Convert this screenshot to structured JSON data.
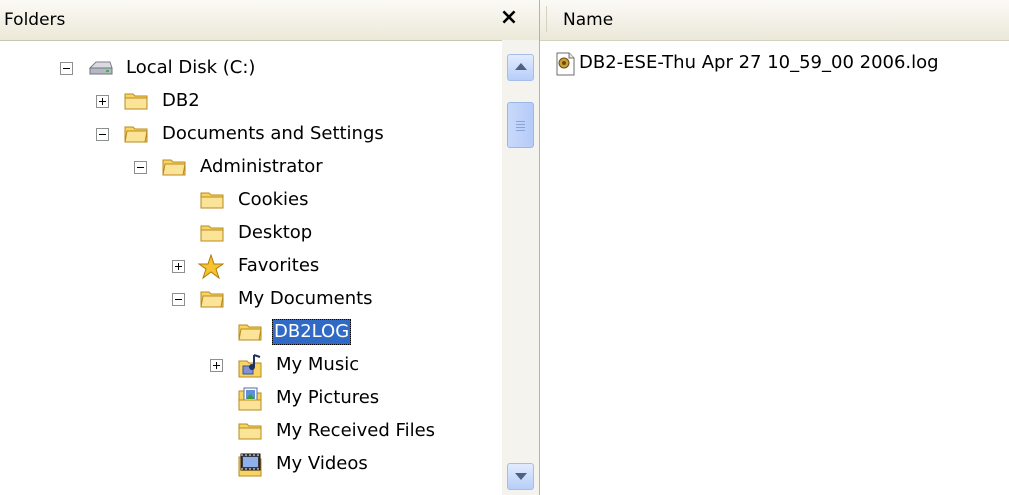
{
  "folders_pane": {
    "title": "Folders",
    "close_glyph": "×"
  },
  "tree": [
    {
      "label": "Local Disk (C:)",
      "icon": "drive-icon",
      "expander": "minus"
    },
    {
      "label": "DB2",
      "icon": "folder-icon",
      "expander": "plus"
    },
    {
      "label": "Documents and Settings",
      "icon": "folder-icon",
      "expander": "minus"
    },
    {
      "label": "Administrator",
      "icon": "folder-icon",
      "expander": "minus"
    },
    {
      "label": "Cookies",
      "icon": "folder-icon",
      "expander": "none"
    },
    {
      "label": "Desktop",
      "icon": "folder-icon",
      "expander": "none"
    },
    {
      "label": "Favorites",
      "icon": "favorites-star-icon",
      "expander": "plus"
    },
    {
      "label": "My Documents",
      "icon": "folder-icon",
      "expander": "minus"
    },
    {
      "label": "DB2LOG",
      "icon": "folder-icon",
      "expander": "none",
      "selected": true
    },
    {
      "label": "My Music",
      "icon": "music-folder-icon",
      "expander": "plus"
    },
    {
      "label": "My Pictures",
      "icon": "pictures-folder-icon",
      "expander": "none"
    },
    {
      "label": "My Received Files",
      "icon": "folder-icon",
      "expander": "none"
    },
    {
      "label": "My Videos",
      "icon": "videos-folder-icon",
      "expander": "none"
    }
  ],
  "files_pane": {
    "column_name": "Name",
    "files": [
      {
        "name": "DB2-ESE-Thu Apr 27 10_59_00 2006.log",
        "icon": "log-file-icon"
      }
    ]
  },
  "colors": {
    "selection": "#316ac5",
    "folder_yellow": "#f7d463",
    "pane_border": "#b8b4a4"
  }
}
